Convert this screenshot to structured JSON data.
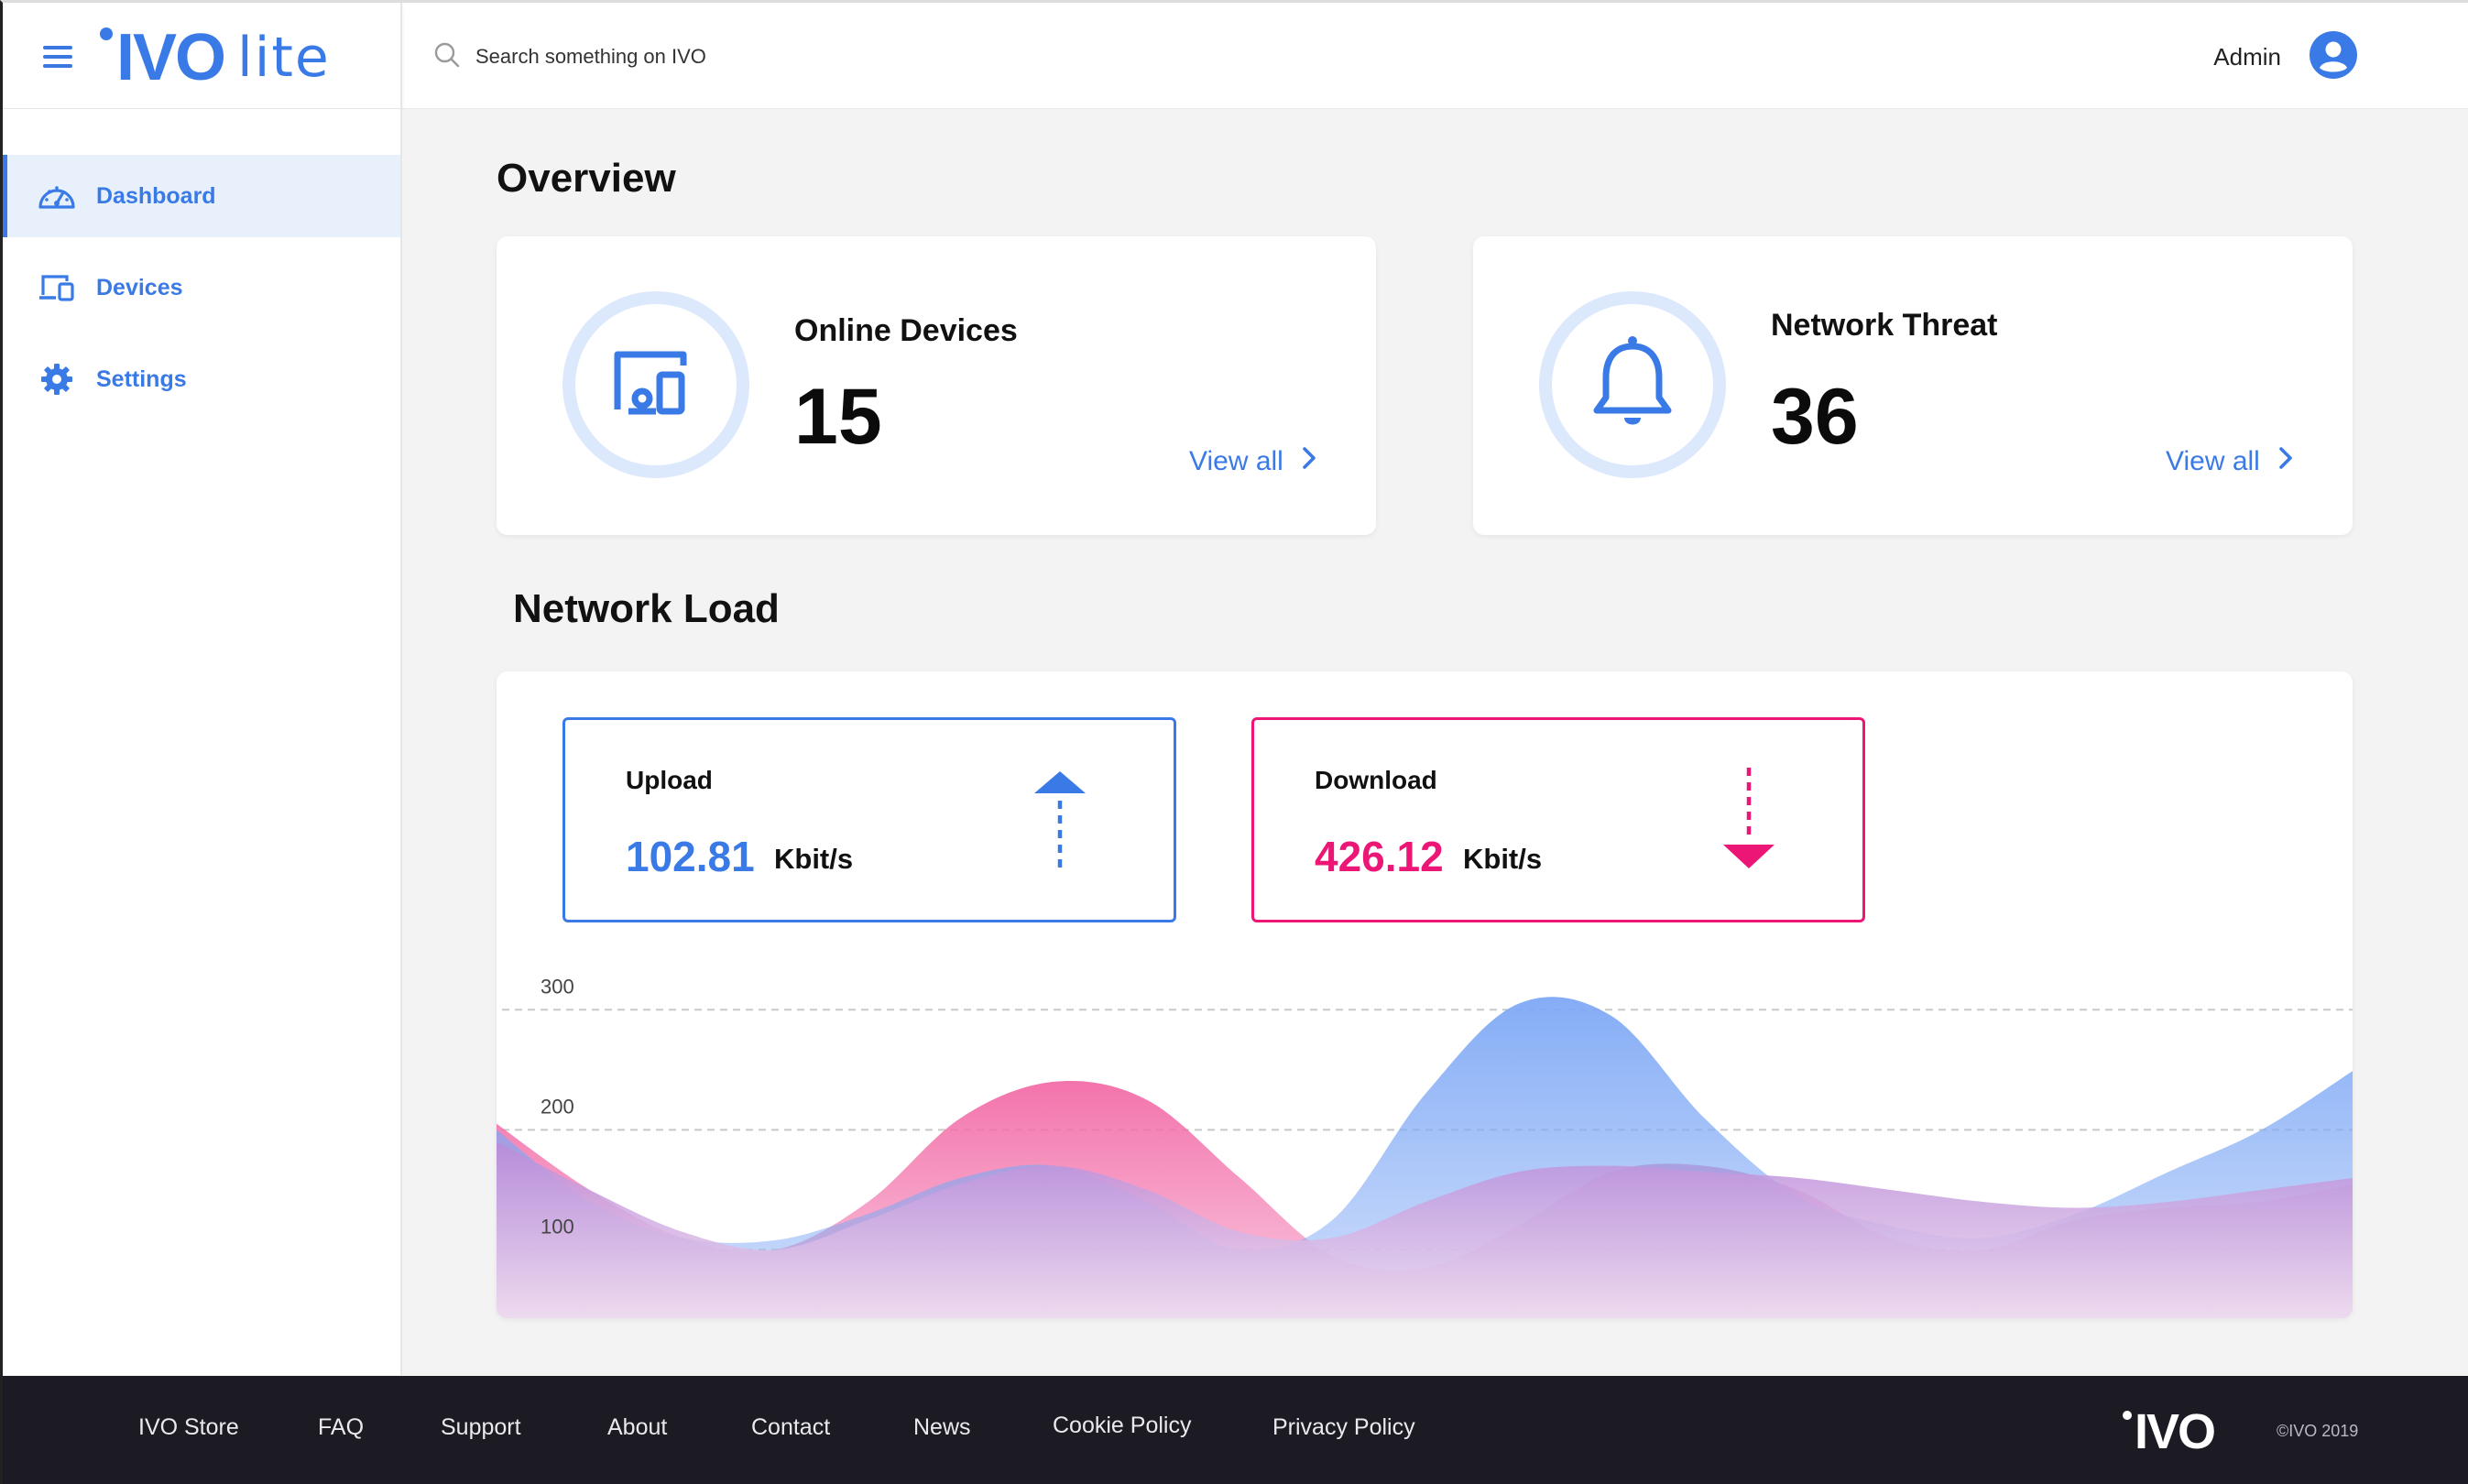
{
  "header": {
    "logo_main": "IVO",
    "logo_sub": "lite",
    "search_placeholder": "Search something on IVO",
    "user_name": "Admin"
  },
  "sidebar": {
    "items": [
      {
        "label": "Dashboard",
        "icon": "dashboard-gauge-icon",
        "active": true
      },
      {
        "label": "Devices",
        "icon": "devices-icon",
        "active": false
      },
      {
        "label": "Settings",
        "icon": "gear-icon",
        "active": false
      }
    ]
  },
  "overview": {
    "title": "Overview",
    "cards": [
      {
        "title": "Online Devices",
        "value": "15",
        "link": "View all",
        "icon": "devices-icon"
      },
      {
        "title": "Network Threat",
        "value": "36",
        "link": "View all",
        "icon": "bell-icon"
      }
    ]
  },
  "network_load": {
    "title": "Network Load",
    "upload": {
      "label": "Upload",
      "value": "102.81",
      "unit": "Kbit/s",
      "color": "#3a7ae6",
      "icon": "arrow-up-icon"
    },
    "download": {
      "label": "Download",
      "value": "426.12",
      "unit": "Kbit/s",
      "color": "#ec1677",
      "icon": "arrow-down-icon"
    }
  },
  "chart_data": {
    "type": "area",
    "title": "",
    "xlabel": "",
    "ylabel": "",
    "yticks": [
      100,
      200,
      300
    ],
    "ylim": [
      40,
      330
    ],
    "grid": true,
    "x": [
      0,
      1,
      2,
      3,
      4,
      5,
      6,
      7,
      8,
      9,
      10,
      11,
      12,
      13,
      14,
      15,
      16,
      17,
      18,
      19,
      20
    ],
    "series": [
      {
        "color": "#f26ca7",
        "values": [
          205,
          150,
          110,
          100,
          140,
          210,
          240,
          225,
          160,
          95,
          85,
          120,
          165,
          170,
          150,
          110,
          100,
          125,
          135,
          140,
          155
        ]
      },
      {
        "color": "#7ea8f5",
        "values": [
          200,
          140,
          110,
          108,
          130,
          160,
          170,
          140,
          100,
          125,
          230,
          305,
          295,
          210,
          145,
          120,
          110,
          130,
          165,
          200,
          250
        ]
      },
      {
        "color": "#b98ad9",
        "values": [
          190,
          150,
          115,
          100,
          125,
          155,
          170,
          150,
          115,
          110,
          140,
          165,
          170,
          165,
          160,
          150,
          140,
          135,
          140,
          150,
          160
        ]
      }
    ]
  },
  "footer": {
    "links": [
      "IVO Store",
      "FAQ",
      "Support",
      "About",
      "Contact",
      "News",
      "Cookie Policy",
      "Privacy Policy"
    ],
    "logo": "IVO",
    "copyright": "©IVO 2019"
  }
}
